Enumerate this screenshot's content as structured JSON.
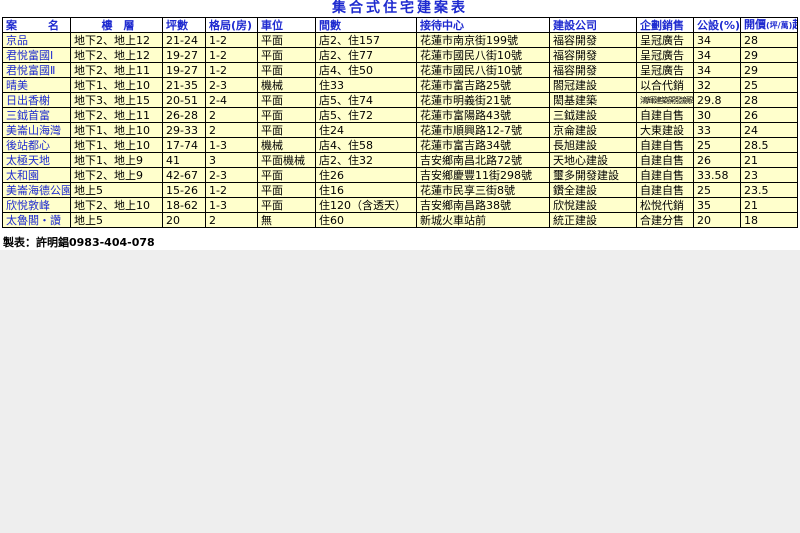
{
  "title": "集合式住宅建案表",
  "headers": {
    "name": "案　名",
    "floors": "樓　層",
    "size": "坪數",
    "layout": "格局(房)",
    "parking": "車位",
    "units": "間數",
    "reception": "接待中心",
    "builder": "建設公司",
    "sales": "企劃銷售",
    "common_ratio": "公設(%)",
    "price_main": "開價",
    "price_unit": "(坪/萬)",
    "price_tail": "起"
  },
  "rows": [
    {
      "name": "京品",
      "floors": "地下2、地上12",
      "size": "21-24",
      "layout": "1-2",
      "parking": "平面",
      "units": "店2、住157",
      "reception": "花蓮市南京街199號",
      "builder": "福容開發",
      "sales": "呈冠廣告",
      "common_ratio": "34",
      "price": "28"
    },
    {
      "name": "君悅富國Ⅰ",
      "floors": "地下2、地上12",
      "size": "19-27",
      "layout": "1-2",
      "parking": "平面",
      "units": "店2、住77",
      "reception": "花蓮市國民八街10號",
      "builder": "福容開發",
      "sales": "呈冠廣告",
      "common_ratio": "34",
      "price": "29"
    },
    {
      "name": "君悅富國Ⅱ",
      "floors": "地下2、地上11",
      "size": "19-27",
      "layout": "1-2",
      "parking": "平面",
      "units": "店4、住50",
      "reception": "花蓮市國民八街10號",
      "builder": "福容開發",
      "sales": "呈冠廣告",
      "common_ratio": "34",
      "price": "29"
    },
    {
      "name": "晴美",
      "floors": "地下1、地上10",
      "size": "21-35",
      "layout": "2-3",
      "parking": "機械",
      "units": "住33",
      "reception": "花蓮市富吉路25號",
      "builder": "閤冠建設",
      "sales": "以合代銷",
      "common_ratio": "32",
      "price": "25"
    },
    {
      "name": "日出香榭",
      "floors": "地下3、地上15",
      "size": "20-51",
      "layout": "2-4",
      "parking": "平面",
      "units": "店5、住74",
      "reception": "花蓮市明義街21號",
      "builder": "閎基建築",
      "sales": "鴻輝建築開發顧問有限公司",
      "common_ratio": "29.8",
      "price": "28"
    },
    {
      "name": "三鉞首富",
      "floors": "地下2、地上11",
      "size": "26-28",
      "layout": "2",
      "parking": "平面",
      "units": "店5、住72",
      "reception": "花蓮市富陽路43號",
      "builder": "三鉞建設",
      "sales": "自建自售",
      "common_ratio": "30",
      "price": "26"
    },
    {
      "name": "美崙山海灣",
      "floors": "地下1、地上10",
      "size": "29-33",
      "layout": "2",
      "parking": "平面",
      "units": "住24",
      "reception": "花蓮市順興路12-7號",
      "builder": "京侖建設",
      "sales": "大東建設",
      "common_ratio": "33",
      "price": "24"
    },
    {
      "name": "後站都心",
      "floors": "地下1、地上10",
      "size": "17-74",
      "layout": "1-3",
      "parking": "機械",
      "units": "店4、住58",
      "reception": "花蓮市富吉路34號",
      "builder": "長旭建設",
      "sales": "自建自售",
      "common_ratio": "25",
      "price": "28.5"
    },
    {
      "name": "太極天地",
      "floors": "地下1、地上9",
      "size": "41",
      "layout": "3",
      "parking": "平面機械",
      "units": "店2、住32",
      "reception": "吉安鄉南昌北路72號",
      "builder": "天地心建設",
      "sales": "自建自售",
      "common_ratio": "26",
      "price": "21"
    },
    {
      "name": "太和園",
      "floors": "地下2、地上9",
      "size": "42-67",
      "layout": "2-3",
      "parking": "平面",
      "units": "住26",
      "reception": "吉安鄉慶豐11街298號",
      "builder": "璽多開發建設",
      "sales": "自建自售",
      "common_ratio": "33.58",
      "price": "23"
    },
    {
      "name": "美崙海德公園",
      "floors": "地上5",
      "size": "15-26",
      "layout": "1-2",
      "parking": "平面",
      "units": "住16",
      "reception": "花蓮市民享三街8號",
      "builder": "鑽全建設",
      "sales": "自建自售",
      "common_ratio": "25",
      "price": "23.5"
    },
    {
      "name": "欣悅敦峰",
      "floors": "地下2、地上10",
      "size": "18-62",
      "layout": "1-3",
      "parking": "平面",
      "units": "住120（含透天）",
      "reception": "吉安鄉南昌路38號",
      "builder": "欣悅建設",
      "sales": "松悅代銷",
      "common_ratio": "35",
      "price": "21"
    },
    {
      "name": "太魯閣・讚",
      "floors": "地上5",
      "size": "20",
      "layout": "2",
      "parking": "無",
      "units": "住60",
      "reception": "新城火車站前",
      "builder": "統正建設",
      "sales": "合建分售",
      "common_ratio": "20",
      "price": "18"
    }
  ],
  "footer": "製表：許明錩0983-404-078",
  "colors": {
    "header_text": "#1f2bd0",
    "cell_bg": "#ffffcc",
    "name_text": "#1f2bd0"
  }
}
